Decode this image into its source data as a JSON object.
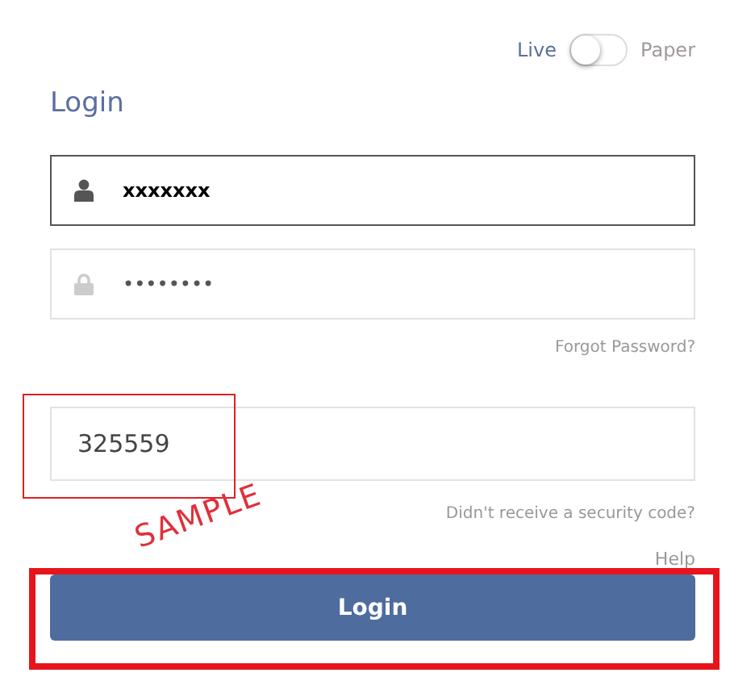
{
  "mode_toggle": {
    "left_label": "Live",
    "right_label": "Paper",
    "on": false
  },
  "heading": "Login",
  "username": {
    "value": "xxxxxxx",
    "focused": true
  },
  "password": {
    "value": "••••••••",
    "focused": false
  },
  "forgot_link": "Forgot Password?",
  "security_code": {
    "value": "325559"
  },
  "resend_link": "Didn't receive a security code?",
  "help_link": "Help",
  "login_button": "Login",
  "annotations": [
    {
      "kind": "code_box"
    },
    {
      "kind": "stamp",
      "text": "SAMPLE"
    },
    {
      "kind": "button_box"
    }
  ]
}
